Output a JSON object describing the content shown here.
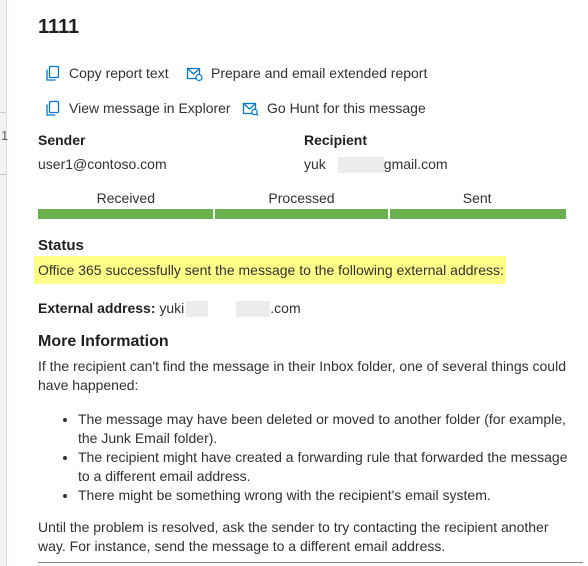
{
  "title": "1111",
  "side": {
    "count": "1"
  },
  "actions": {
    "copy_report": "Copy report text",
    "prepare_email": "Prepare and email extended report",
    "view_explorer": "View message in Explorer",
    "go_hunt": "Go Hunt for this message"
  },
  "sender": {
    "label": "Sender",
    "value": "user1@contoso.com"
  },
  "recipient": {
    "label": "Recipient",
    "prefix": "yuk",
    "suffix": "gmail.com"
  },
  "progress": {
    "steps": [
      {
        "label": "Received",
        "complete": true
      },
      {
        "label": "Processed",
        "complete": true
      },
      {
        "label": "Sent",
        "complete": true
      }
    ],
    "color": "#6ab04c"
  },
  "status": {
    "heading": "Status",
    "message": "Office 365 successfully sent the message to the following external address:",
    "highlight_color": "#ffff88"
  },
  "external": {
    "label": "External address:",
    "prefix": "yuki",
    "suffix": ".com"
  },
  "more_info": {
    "heading": "More Information",
    "intro": "If the recipient can't find the message in their Inbox folder, one of several things could have happened:",
    "bullets": [
      "The message may have been deleted or moved to another folder (for example, the Junk Email folder).",
      "The recipient might have created a forwarding rule that forwarded the message to a different email address.",
      "There might be something wrong with the recipient's email system."
    ],
    "closing": "Until the problem is resolved, ask the sender to try contacting the recipient another way. For instance, send the message to a different email address."
  },
  "icons": {
    "copy": "copy-icon",
    "email": "email-icon",
    "explorer": "copy-icon",
    "hunt": "hunt-icon"
  },
  "colors": {
    "icon_blue": "#0078d4",
    "text": "#323130"
  }
}
